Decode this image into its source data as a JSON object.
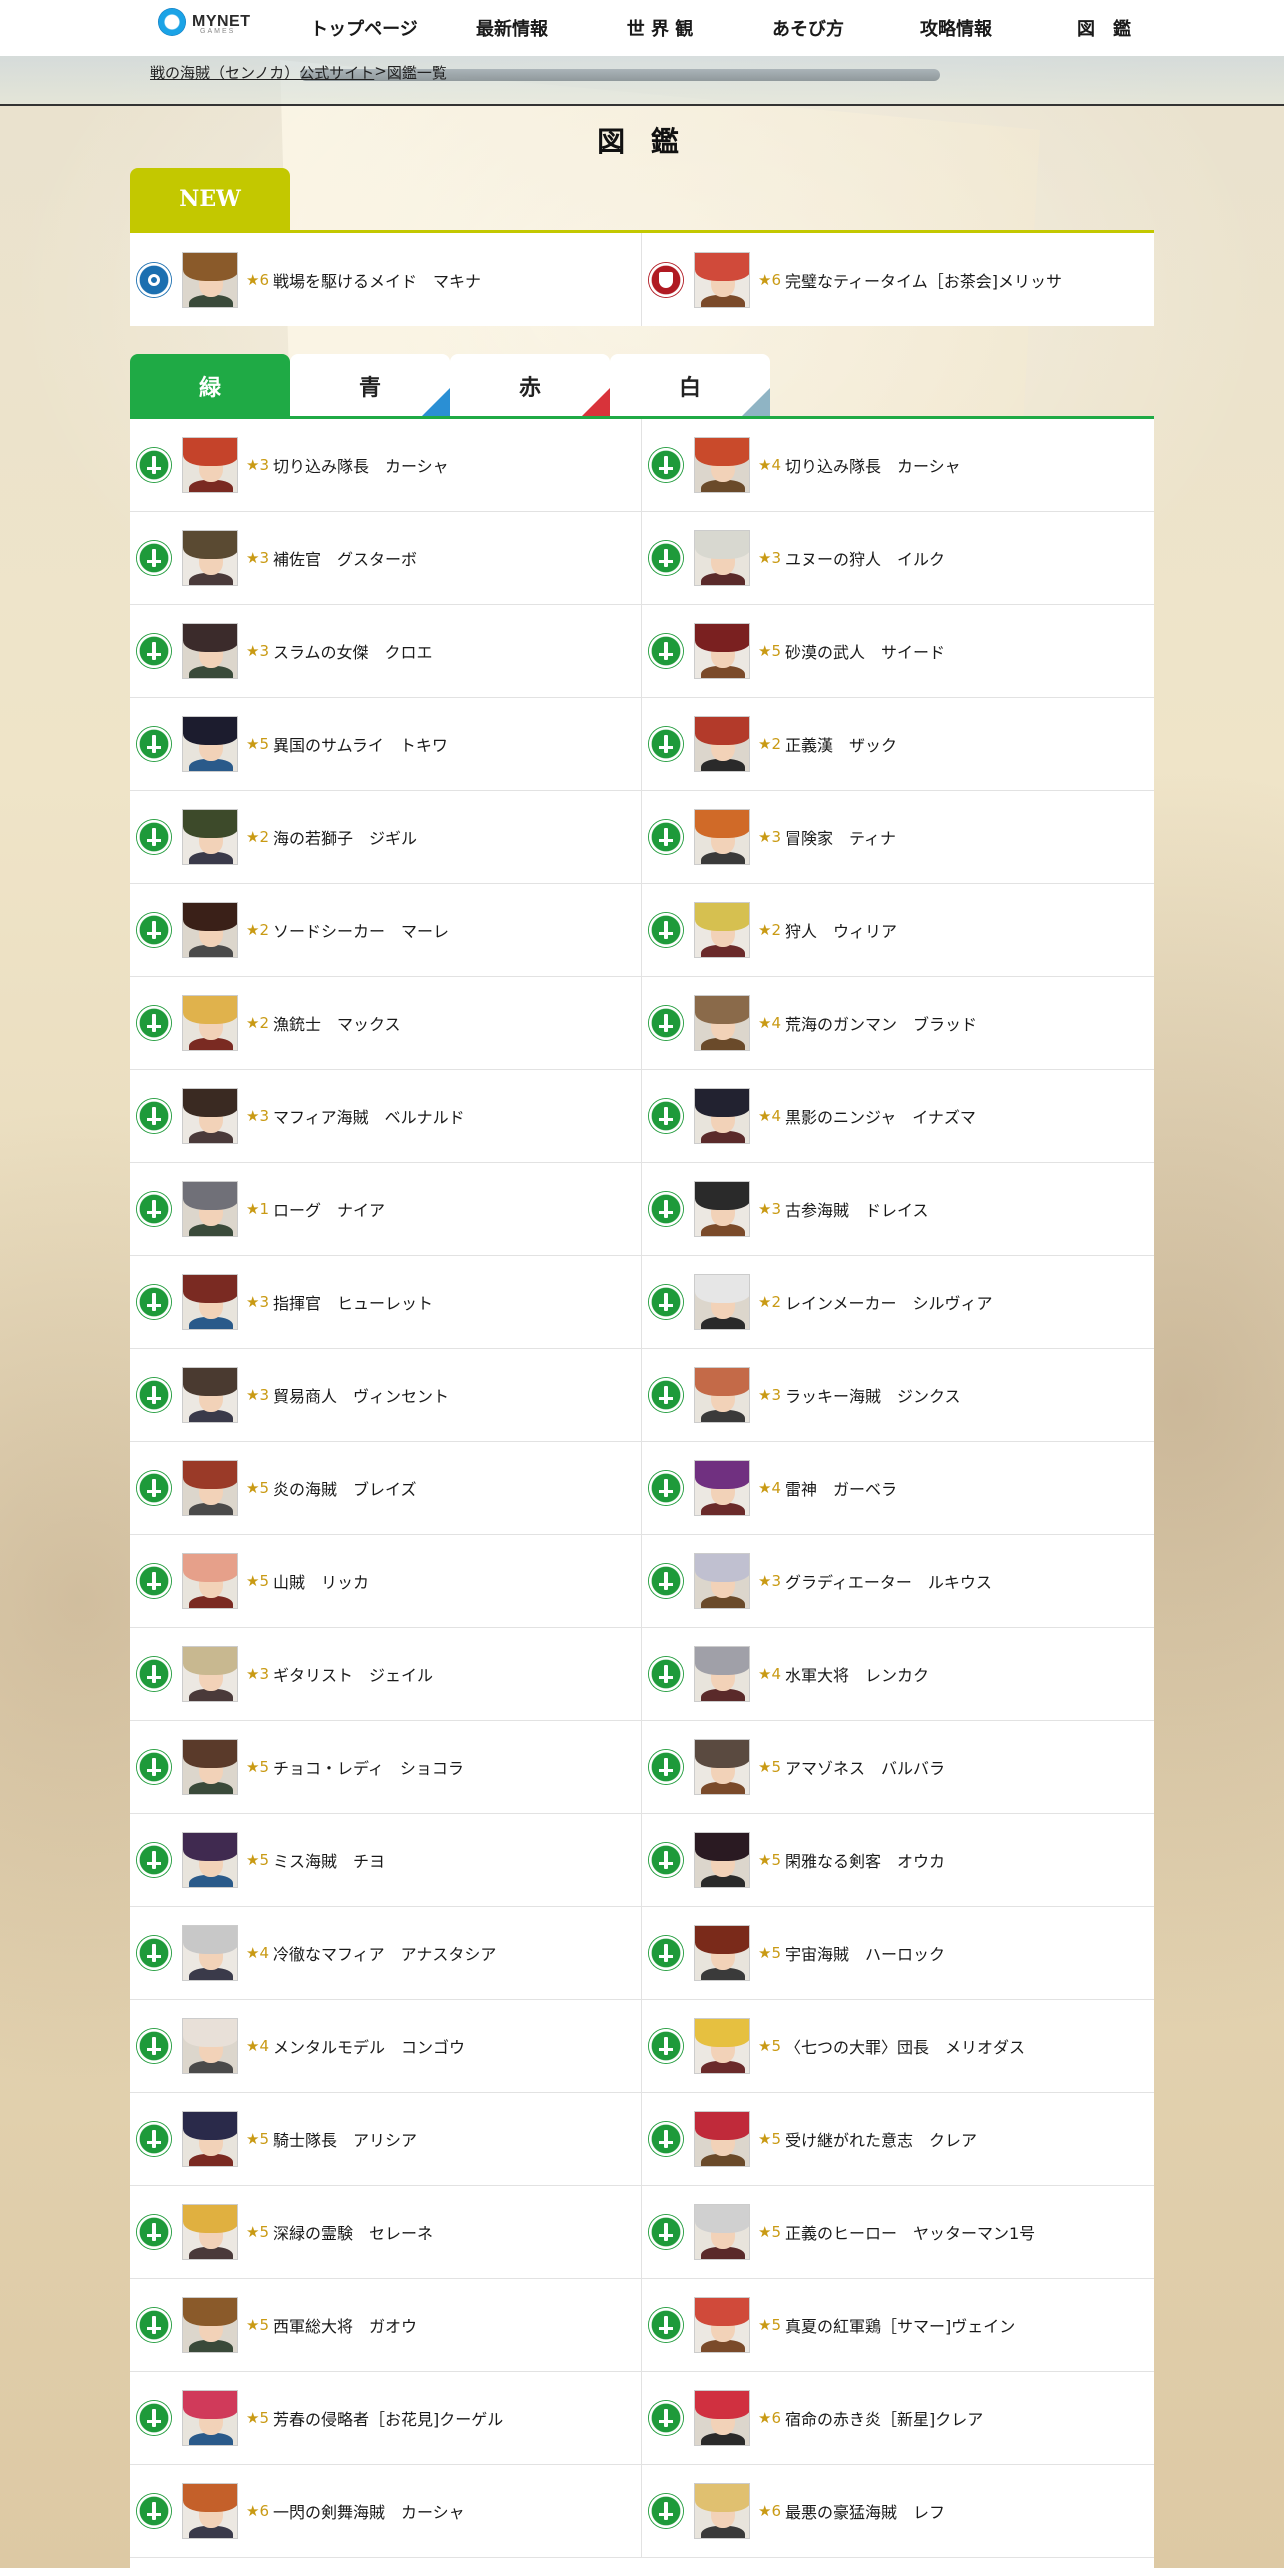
{
  "header": {
    "logo_text": "MYNET",
    "logo_sub": "GAMES",
    "nav": [
      "トップページ",
      "最新情報",
      "世 界 観",
      "あそび方",
      "攻略情報",
      "図　鑑"
    ]
  },
  "breadcrumb": {
    "items": [
      "戦の海賊（センノカ）公式サイト",
      "図鑑一覧"
    ],
    "separator": " > "
  },
  "page_title": "図 鑑",
  "new_section": {
    "label": "NEW",
    "items": [
      {
        "rarity": "★6",
        "name": "戦場を駆けるメイド　マキナ",
        "type": "blue",
        "icon": "key-icon"
      },
      {
        "rarity": "★6",
        "name": "完璧なティータイム［お茶会]メリッサ",
        "type": "red",
        "icon": "shield-icon"
      }
    ]
  },
  "tabs": [
    {
      "label": "緑",
      "active": true,
      "color": "#1faa45"
    },
    {
      "label": "青",
      "active": false,
      "color": "#2a8fd4"
    },
    {
      "label": "赤",
      "active": false,
      "color": "#d8333a"
    },
    {
      "label": "白",
      "active": false,
      "color": "#8fb4c4"
    }
  ],
  "characters": [
    [
      {
        "r": "★3",
        "n": "切り込み隊長　カーシャ"
      },
      {
        "r": "★4",
        "n": "切り込み隊長　カーシャ"
      }
    ],
    [
      {
        "r": "★3",
        "n": "補佐官　グスターボ"
      },
      {
        "r": "★3",
        "n": "ユヌーの狩人　イルク"
      }
    ],
    [
      {
        "r": "★3",
        "n": "スラムの女傑　クロエ"
      },
      {
        "r": "★5",
        "n": "砂漠の武人　サイード"
      }
    ],
    [
      {
        "r": "★5",
        "n": "異国のサムライ　トキワ"
      },
      {
        "r": "★2",
        "n": "正義漢　ザック"
      }
    ],
    [
      {
        "r": "★2",
        "n": "海の若獅子　ジギル"
      },
      {
        "r": "★3",
        "n": "冒険家　ティナ"
      }
    ],
    [
      {
        "r": "★2",
        "n": "ソードシーカー　マーレ"
      },
      {
        "r": "★2",
        "n": "狩人　ウィリア"
      }
    ],
    [
      {
        "r": "★2",
        "n": "漁銃士　マックス"
      },
      {
        "r": "★4",
        "n": "荒海のガンマン　ブラッド"
      }
    ],
    [
      {
        "r": "★3",
        "n": "マフィア海賊　ベルナルド"
      },
      {
        "r": "★4",
        "n": "黒影のニンジャ　イナズマ"
      }
    ],
    [
      {
        "r": "★1",
        "n": "ローグ　ナイア"
      },
      {
        "r": "★3",
        "n": "古参海賊　ドレイス"
      }
    ],
    [
      {
        "r": "★3",
        "n": "指揮官　ヒューレット"
      },
      {
        "r": "★2",
        "n": "レインメーカー　シルヴィア"
      }
    ],
    [
      {
        "r": "★3",
        "n": "貿易商人　ヴィンセント"
      },
      {
        "r": "★3",
        "n": "ラッキー海賊　ジンクス"
      }
    ],
    [
      {
        "r": "★5",
        "n": "炎の海賊　ブレイズ"
      },
      {
        "r": "★4",
        "n": "雷神　ガーベラ"
      }
    ],
    [
      {
        "r": "★5",
        "n": "山賊　リッカ"
      },
      {
        "r": "★3",
        "n": "グラディエーター　ルキウス"
      }
    ],
    [
      {
        "r": "★3",
        "n": "ギタリスト　ジェイル"
      },
      {
        "r": "★4",
        "n": "水軍大将　レンカク"
      }
    ],
    [
      {
        "r": "★5",
        "n": "チョコ・レディ　ショコラ"
      },
      {
        "r": "★5",
        "n": "アマゾネス　バルバラ"
      }
    ],
    [
      {
        "r": "★5",
        "n": "ミス海賊　チヨ"
      },
      {
        "r": "★5",
        "n": "閑雅なる剣客　オウカ"
      }
    ],
    [
      {
        "r": "★4",
        "n": "冷徹なマフィア　アナスタシア"
      },
      {
        "r": "★5",
        "n": "宇宙海賊　ハーロック"
      }
    ],
    [
      {
        "r": "★4",
        "n": "メンタルモデル　コンゴウ"
      },
      {
        "r": "★5",
        "n": "〈七つの大罪〉団長　メリオダス"
      }
    ],
    [
      {
        "r": "★5",
        "n": "騎士隊長　アリシア"
      },
      {
        "r": "★5",
        "n": "受け継がれた意志　クレア"
      }
    ],
    [
      {
        "r": "★5",
        "n": "深緑の霊験　セレーネ"
      },
      {
        "r": "★5",
        "n": "正義のヒーロー　ヤッターマン1号"
      }
    ],
    [
      {
        "r": "★5",
        "n": "西軍総大将　ガオウ"
      },
      {
        "r": "★5",
        "n": "真夏の紅軍鶏［サマー]ヴェイン"
      }
    ],
    [
      {
        "r": "★5",
        "n": "芳春の侵略者［お花見]クーゲル"
      },
      {
        "r": "★6",
        "n": "宿命の赤き炎［新星]クレア"
      }
    ],
    [
      {
        "r": "★6",
        "n": "一閃の剣舞海賊　カーシャ"
      },
      {
        "r": "★6",
        "n": "最悪の豪猛海賊　レフ"
      }
    ]
  ],
  "avatar_palette": {
    "hair": [
      "#c5432a",
      "#c94a2b",
      "#5a4a32",
      "#d8d8d0",
      "#3b2b2b",
      "#7a2020",
      "#1c1c2e",
      "#b33a2a",
      "#3d4a2a",
      "#d06a28",
      "#3a2018",
      "#d6c050",
      "#e0b24c",
      "#8a6a4a",
      "#3a2a22",
      "#222230",
      "#707078",
      "#2a2a2a",
      "#7a2a22",
      "#e6e6e6",
      "#4a3a30",
      "#c46a48",
      "#9a3a28",
      "#703080",
      "#e6a08a",
      "#c0c0d0",
      "#c8b890",
      "#a0a0a8",
      "#5a3a2a",
      "#5a4a40",
      "#402a50",
      "#2a1a22",
      "#c8c8c8",
      "#7a2a1a",
      "#e8e0d8",
      "#e6c040",
      "#2a2a4a",
      "#c02a3a",
      "#e0b040",
      "#d0d0d0",
      "#8a5a2a",
      "#d04a3a",
      "#d03a5a",
      "#d03040",
      "#c4602a",
      "#e0c070"
    ],
    "body": [
      "#7a2a22",
      "#6a4a2a",
      "#4a3a3a",
      "#5a2a2a",
      "#3a4a3a",
      "#7a4a2a",
      "#2a5a8a",
      "#2a2a2a",
      "#3a3a4a",
      "#3a3a3a",
      "#4a4a4a",
      "#6a2a2a"
    ]
  }
}
